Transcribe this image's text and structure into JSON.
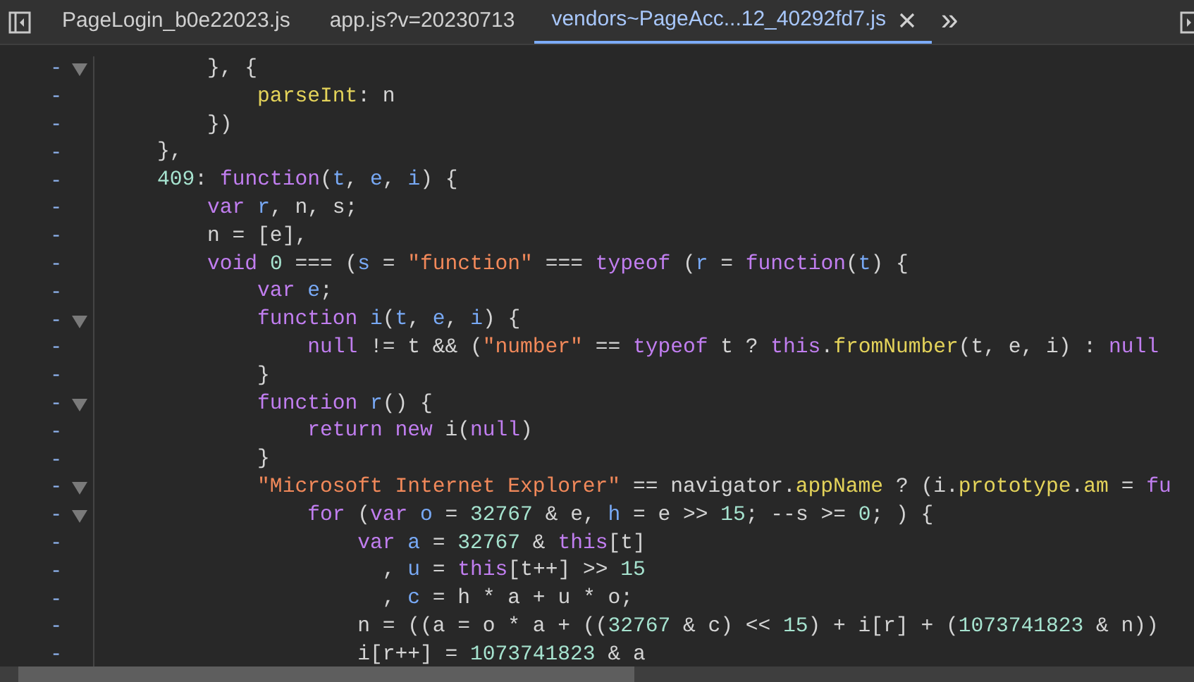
{
  "tabs": [
    {
      "label": "PageLogin_b0e22023.js",
      "selected": false
    },
    {
      "label": "app.js?v=20230713",
      "selected": false
    },
    {
      "label": "vendors~PageAcc...12_40292fd7.js",
      "selected": true
    }
  ],
  "overflow": "»",
  "lines": [
    {
      "marker": "-",
      "fold": true,
      "tokens": [
        {
          "kind": "plain",
          "text": "        }, {"
        }
      ]
    },
    {
      "marker": "-",
      "fold": false,
      "tokens": [
        {
          "kind": "prop",
          "text": "            parseInt"
        },
        {
          "kind": "plain",
          "text": ": n"
        }
      ]
    },
    {
      "marker": "-",
      "fold": false,
      "tokens": [
        {
          "kind": "plain",
          "text": "        })"
        }
      ]
    },
    {
      "marker": "-",
      "fold": false,
      "tokens": [
        {
          "kind": "plain",
          "text": "    },"
        }
      ]
    },
    {
      "marker": "-",
      "fold": false,
      "tokens": [
        {
          "kind": "num",
          "text": "    409"
        },
        {
          "kind": "plain",
          "text": ": "
        },
        {
          "kind": "kw",
          "text": "function"
        },
        {
          "kind": "plain",
          "text": "("
        },
        {
          "kind": "var",
          "text": "t"
        },
        {
          "kind": "plain",
          "text": ", "
        },
        {
          "kind": "var",
          "text": "e"
        },
        {
          "kind": "plain",
          "text": ", "
        },
        {
          "kind": "var",
          "text": "i"
        },
        {
          "kind": "plain",
          "text": ") {"
        }
      ]
    },
    {
      "marker": "-",
      "fold": false,
      "tokens": [
        {
          "kind": "kw",
          "text": "        var"
        },
        {
          "kind": "var",
          "text": " r"
        },
        {
          "kind": "plain",
          "text": ", n, s;"
        }
      ]
    },
    {
      "marker": "-",
      "fold": false,
      "tokens": [
        {
          "kind": "plain",
          "text": "        n = [e],"
        }
      ]
    },
    {
      "marker": "-",
      "fold": false,
      "tokens": [
        {
          "kind": "kw",
          "text": "        void"
        },
        {
          "kind": "num",
          "text": " 0"
        },
        {
          "kind": "plain",
          "text": " === ("
        },
        {
          "kind": "var",
          "text": "s"
        },
        {
          "kind": "plain",
          "text": " = "
        },
        {
          "kind": "str",
          "text": "\"function\""
        },
        {
          "kind": "plain",
          "text": " === "
        },
        {
          "kind": "kw",
          "text": "typeof"
        },
        {
          "kind": "plain",
          "text": " ("
        },
        {
          "kind": "var",
          "text": "r"
        },
        {
          "kind": "plain",
          "text": " = "
        },
        {
          "kind": "kw",
          "text": "function"
        },
        {
          "kind": "plain",
          "text": "("
        },
        {
          "kind": "var",
          "text": "t"
        },
        {
          "kind": "plain",
          "text": ") {"
        }
      ]
    },
    {
      "marker": "-",
      "fold": false,
      "tokens": [
        {
          "kind": "kw",
          "text": "            var"
        },
        {
          "kind": "var",
          "text": " e"
        },
        {
          "kind": "plain",
          "text": ";"
        }
      ]
    },
    {
      "marker": "-",
      "fold": true,
      "tokens": [
        {
          "kind": "kw",
          "text": "            function"
        },
        {
          "kind": "var",
          "text": " i"
        },
        {
          "kind": "plain",
          "text": "("
        },
        {
          "kind": "var",
          "text": "t"
        },
        {
          "kind": "plain",
          "text": ", "
        },
        {
          "kind": "var",
          "text": "e"
        },
        {
          "kind": "plain",
          "text": ", "
        },
        {
          "kind": "var",
          "text": "i"
        },
        {
          "kind": "plain",
          "text": ") {"
        }
      ]
    },
    {
      "marker": "-",
      "fold": false,
      "tokens": [
        {
          "kind": "kw",
          "text": "                null"
        },
        {
          "kind": "plain",
          "text": " != t && ("
        },
        {
          "kind": "str",
          "text": "\"number\""
        },
        {
          "kind": "plain",
          "text": " == "
        },
        {
          "kind": "kw",
          "text": "typeof"
        },
        {
          "kind": "plain",
          "text": " t ? "
        },
        {
          "kind": "kw",
          "text": "this"
        },
        {
          "kind": "plain",
          "text": "."
        },
        {
          "kind": "prop",
          "text": "fromNumber"
        },
        {
          "kind": "plain",
          "text": "(t, e, i) : "
        },
        {
          "kind": "kw",
          "text": "null"
        }
      ]
    },
    {
      "marker": "-",
      "fold": false,
      "tokens": [
        {
          "kind": "plain",
          "text": "            }"
        }
      ]
    },
    {
      "marker": "-",
      "fold": true,
      "tokens": [
        {
          "kind": "kw",
          "text": "            function"
        },
        {
          "kind": "var",
          "text": " r"
        },
        {
          "kind": "plain",
          "text": "() {"
        }
      ]
    },
    {
      "marker": "-",
      "fold": false,
      "tokens": [
        {
          "kind": "kw",
          "text": "                return new"
        },
        {
          "kind": "plain",
          "text": " i("
        },
        {
          "kind": "kw",
          "text": "null"
        },
        {
          "kind": "plain",
          "text": ")"
        }
      ]
    },
    {
      "marker": "-",
      "fold": false,
      "tokens": [
        {
          "kind": "plain",
          "text": "            }"
        }
      ]
    },
    {
      "marker": "-",
      "fold": true,
      "tokens": [
        {
          "kind": "str",
          "text": "            \"Microsoft Internet Explorer\""
        },
        {
          "kind": "plain",
          "text": " == navigator."
        },
        {
          "kind": "prop",
          "text": "appName"
        },
        {
          "kind": "plain",
          "text": " ? (i."
        },
        {
          "kind": "prop",
          "text": "prototype"
        },
        {
          "kind": "plain",
          "text": "."
        },
        {
          "kind": "prop",
          "text": "am"
        },
        {
          "kind": "plain",
          "text": " = "
        },
        {
          "kind": "kw",
          "text": "fu"
        }
      ]
    },
    {
      "marker": "-",
      "fold": true,
      "tokens": [
        {
          "kind": "kw",
          "text": "                for"
        },
        {
          "kind": "plain",
          "text": " ("
        },
        {
          "kind": "kw",
          "text": "var"
        },
        {
          "kind": "var",
          "text": " o"
        },
        {
          "kind": "plain",
          "text": " = "
        },
        {
          "kind": "num",
          "text": "32767"
        },
        {
          "kind": "plain",
          "text": " & e, "
        },
        {
          "kind": "var",
          "text": "h"
        },
        {
          "kind": "plain",
          "text": " = e >> "
        },
        {
          "kind": "num",
          "text": "15"
        },
        {
          "kind": "plain",
          "text": "; --s >= "
        },
        {
          "kind": "num",
          "text": "0"
        },
        {
          "kind": "plain",
          "text": "; ) {"
        }
      ]
    },
    {
      "marker": "-",
      "fold": false,
      "tokens": [
        {
          "kind": "kw",
          "text": "                    var"
        },
        {
          "kind": "var",
          "text": " a"
        },
        {
          "kind": "plain",
          "text": " = "
        },
        {
          "kind": "num",
          "text": "32767"
        },
        {
          "kind": "plain",
          "text": " & "
        },
        {
          "kind": "kw",
          "text": "this"
        },
        {
          "kind": "plain",
          "text": "[t]"
        }
      ]
    },
    {
      "marker": "-",
      "fold": false,
      "tokens": [
        {
          "kind": "plain",
          "text": "                      , "
        },
        {
          "kind": "var",
          "text": "u"
        },
        {
          "kind": "plain",
          "text": " = "
        },
        {
          "kind": "kw",
          "text": "this"
        },
        {
          "kind": "plain",
          "text": "[t++] >> "
        },
        {
          "kind": "num",
          "text": "15"
        }
      ]
    },
    {
      "marker": "-",
      "fold": false,
      "tokens": [
        {
          "kind": "plain",
          "text": "                      , "
        },
        {
          "kind": "var",
          "text": "c"
        },
        {
          "kind": "plain",
          "text": " = h * a + u * o;"
        }
      ]
    },
    {
      "marker": "-",
      "fold": false,
      "tokens": [
        {
          "kind": "plain",
          "text": "                    n = ((a = o * a + (("
        },
        {
          "kind": "num",
          "text": "32767"
        },
        {
          "kind": "plain",
          "text": " & c) << "
        },
        {
          "kind": "num",
          "text": "15"
        },
        {
          "kind": "plain",
          "text": ") + i[r] + ("
        },
        {
          "kind": "num",
          "text": "1073741823"
        },
        {
          "kind": "plain",
          "text": " & n))"
        }
      ]
    },
    {
      "marker": "-",
      "fold": false,
      "tokens": [
        {
          "kind": "plain",
          "text": "                    i[r++] = "
        },
        {
          "kind": "num",
          "text": "1073741823"
        },
        {
          "kind": "plain",
          "text": " & a"
        }
      ]
    }
  ]
}
